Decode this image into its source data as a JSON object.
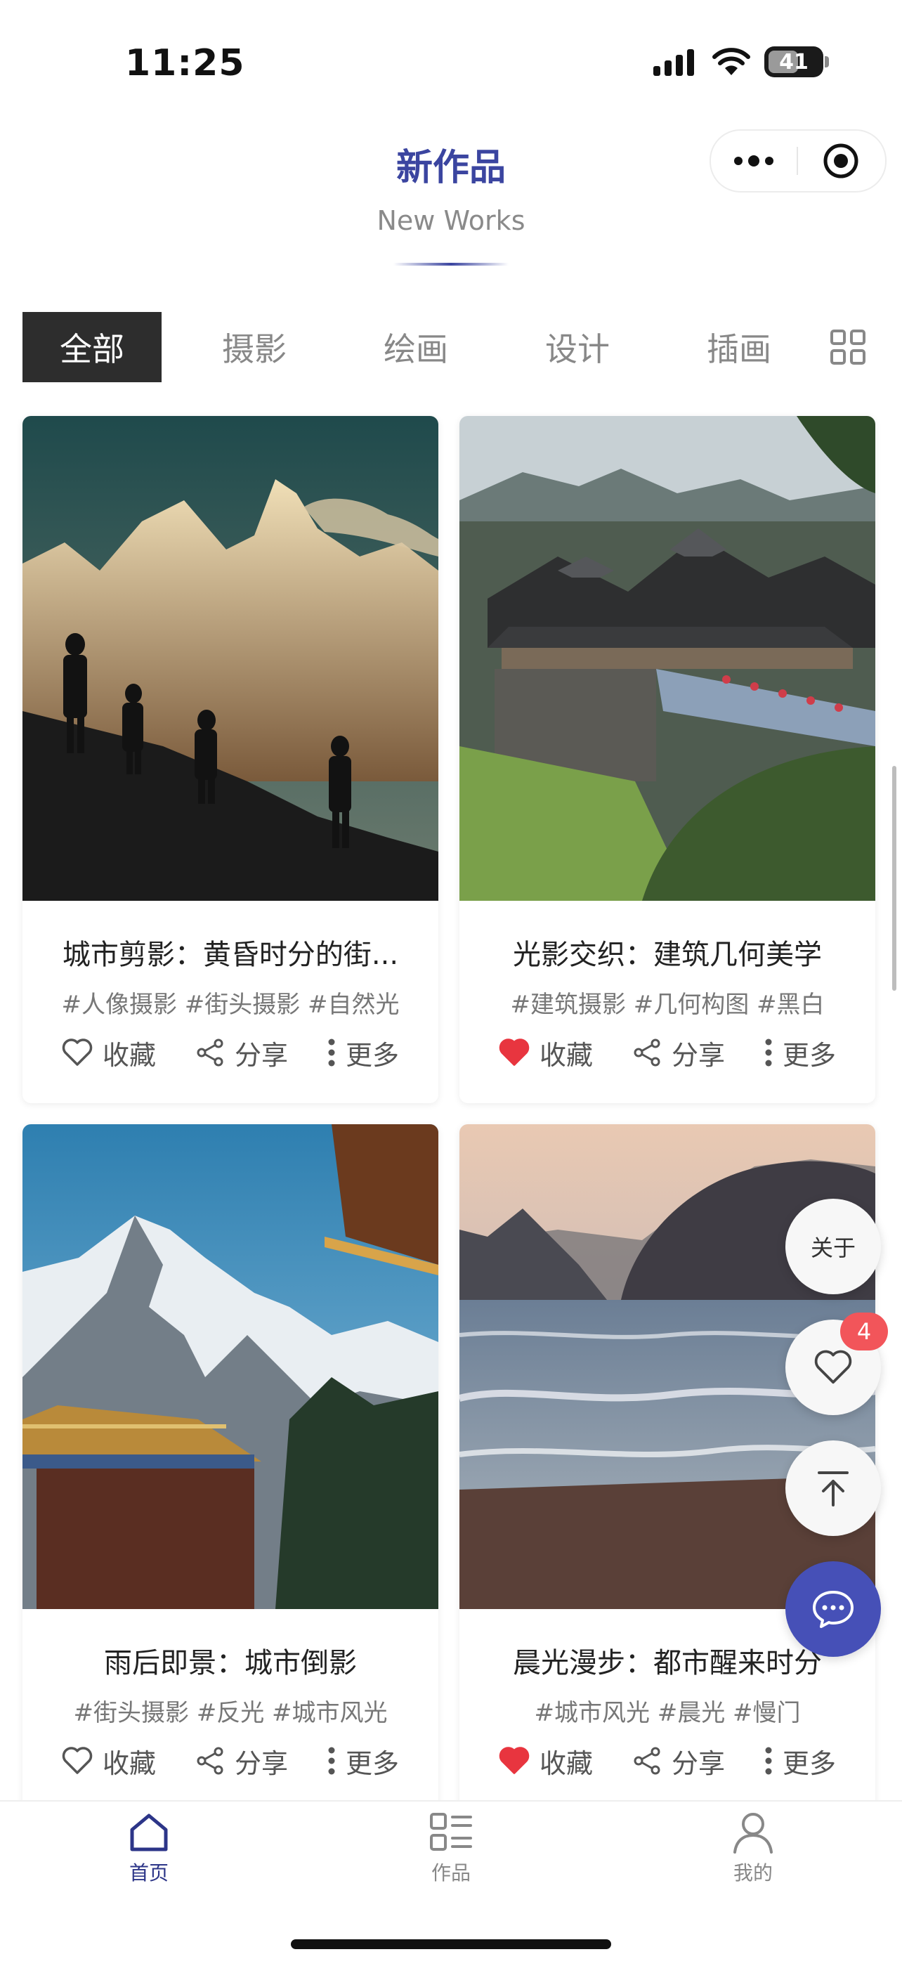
{
  "status_bar": {
    "time": "11:25",
    "battery": "41"
  },
  "header": {
    "title": "新作品",
    "subtitle": "New Works"
  },
  "capsule": {
    "more_icon": "ellipsis-icon",
    "close_icon": "target-icon"
  },
  "tabs": [
    {
      "label": "全部",
      "active": true
    },
    {
      "label": "摄影"
    },
    {
      "label": "绘画"
    },
    {
      "label": "设计"
    },
    {
      "label": "插画"
    }
  ],
  "cards": [
    {
      "title": "城市剪影：黄昏时分的街...",
      "tags": "#人像摄影 #街头摄影 #自然光",
      "favorite_label": "收藏",
      "share_label": "分享",
      "more_label": "更多",
      "favorited": false
    },
    {
      "title": "光影交织：建筑几何美学",
      "tags": "#建筑摄影 #几何构图 #黑白",
      "favorite_label": "收藏",
      "share_label": "分享",
      "more_label": "更多",
      "favorited": true
    },
    {
      "title": "雨后即景：城市倒影",
      "tags": "#街头摄影 #反光 #城市风光",
      "favorite_label": "收藏",
      "share_label": "分享",
      "more_label": "更多",
      "favorited": false
    },
    {
      "title": "晨光漫步：都市醒来时分",
      "tags": "#城市风光 #晨光 #慢门",
      "favorite_label": "收藏",
      "share_label": "分享",
      "more_label": "更多",
      "favorited": true
    }
  ],
  "floating": {
    "about_label": "关于",
    "favorites_count": "4"
  },
  "bottom_nav": [
    {
      "label": "首页",
      "icon": "home-icon",
      "active": true
    },
    {
      "label": "作品",
      "icon": "works-list-icon"
    },
    {
      "label": "我的",
      "icon": "profile-icon"
    }
  ],
  "colors": {
    "accent": "#3b45a0",
    "heart_active": "#e8353f",
    "chat_fab": "#4650b7"
  }
}
